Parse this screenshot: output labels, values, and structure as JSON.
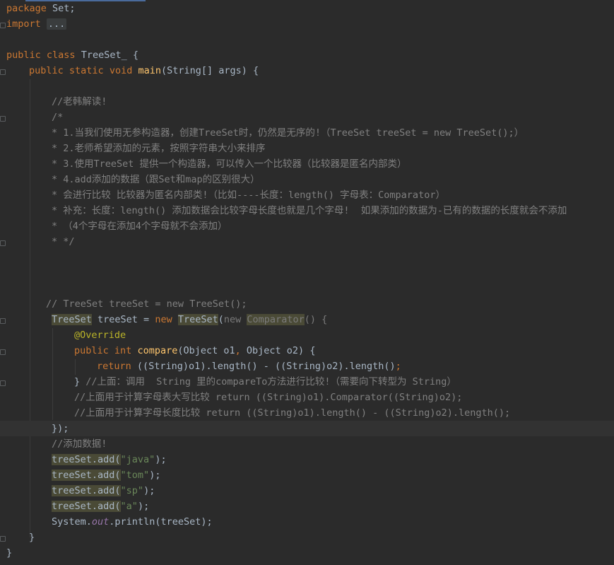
{
  "code": {
    "l1_kw": "package",
    "l1_rest": " Set;",
    "l2_kw": "import",
    "l2_fold": "...",
    "l4_kw1": "public",
    "l4_kw2": "class",
    "l4_name": "TreeSet_",
    "l4_brace": " {",
    "l5_kw1": "public",
    "l5_kw2": "static",
    "l5_kw3": "void",
    "l5_fn": "main",
    "l5_rest": "(String[] args) {",
    "c1": "//老韩解读!",
    "c2": "/*",
    "c3": "* 1.当我们使用无参构造器，创建TreeSet时，仍然是无序的!（TreeSet treeSet = new TreeSet();）",
    "c4": "* 2.老师希望添加的元素，按照字符串大小来排序",
    "c5": "* 3.使用TreeSet 提供一个构造器，可以传入一个比较器（比较器是匿名内部类）",
    "c6": "* 4.add添加的数据（跟Set和map的区别很大）",
    "c7": "* 会进行比较 比较器为匿名内部类!（比如----长度：length() 字母表：Comparator）",
    "c8": "* 补充：长度：length() 添加数据会比较字母长度也就是几个字母!  如果添加的数据为-已有的数据的长度就会不添加",
    "c9": "* （4个字母在添加4个字母就不会添加）",
    "c10": "* */",
    "c11": "// TreeSet treeSet = new TreeSet();",
    "l_ts_type": "TreeSet",
    "l_ts_var": " treeSet = ",
    "l_ts_new": "new",
    "l_ts_ctor": "TreeSet",
    "l_ts_paren": "(",
    "l_ts_new2": "new",
    "l_ts_cmp": "Comparator",
    "l_ts_end": "() {",
    "override": "@Override",
    "cmp_kw1": "public",
    "cmp_kw2": "int",
    "cmp_fn": "compare",
    "cmp_args1": "(Object o1",
    "cmp_comma": ",",
    "cmp_args2": " Object o2) {",
    "ret_kw": "return",
    "ret_rest": " ((String)o1).length() - ((String)o2).length()",
    "ret_semi": ";",
    "close1_brace": "}",
    "close1_cm": " //上面：调用  String 里的compareTo方法进行比较!（需要向下转型为 String）",
    "cm_upper": "//上面用于计算字母表大写比较 return ((String)o1).Comparator((String)o2);",
    "cm_len": "//上面用于计算字母长度比较 return ((String)o1).length() - ((String)o2).length();",
    "close2": "});",
    "cm_add": "//添加数据!",
    "add_call": "treeSet.add(",
    "add_close": ");",
    "adds": [
      "\"java\"",
      "\"tom\"",
      "\"sp\"",
      "\"a\""
    ],
    "println_pre": "System.",
    "println_out": "out",
    "println_rest": ".println(treeSet);",
    "close_main": "}",
    "close_class": "}"
  }
}
